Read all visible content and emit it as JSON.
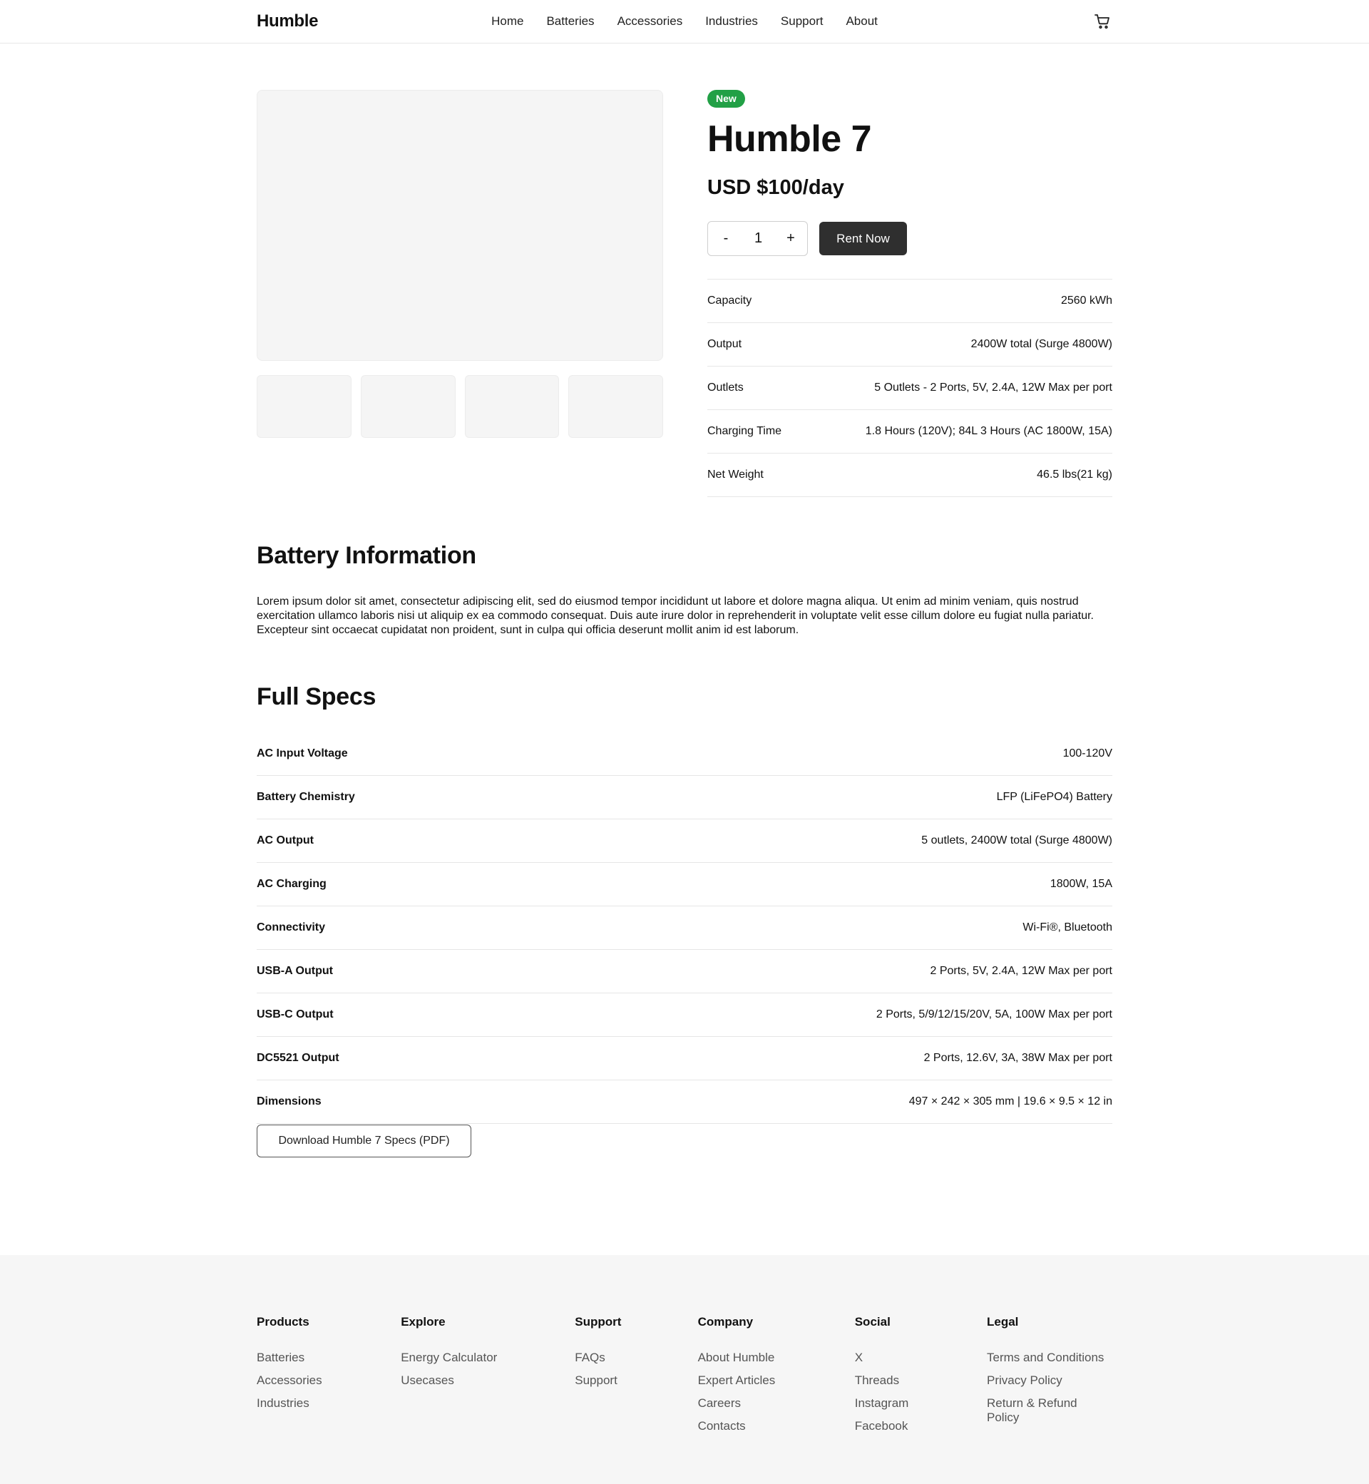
{
  "header": {
    "logo": "Humble",
    "nav": [
      "Home",
      "Batteries",
      "Accessories",
      "Industries",
      "Support",
      "About"
    ]
  },
  "product": {
    "badge": "New",
    "title": "Humble 7",
    "price": "USD $100/day",
    "quantity": {
      "minus": "-",
      "value": "1",
      "plus": "+"
    },
    "rent_label": "Rent Now",
    "key_specs": [
      {
        "label": "Capacity",
        "value": "2560 kWh"
      },
      {
        "label": "Output",
        "value": "2400W total (Surge 4800W)"
      },
      {
        "label": "Outlets",
        "value": "5 Outlets - 2 Ports, 5V, 2.4A, 12W Max per port"
      },
      {
        "label": "Charging Time",
        "value": "1.8 Hours (120V); 84L 3 Hours (AC 1800W, 15A)"
      },
      {
        "label": "Net Weight",
        "value": "46.5 lbs(21 kg)"
      }
    ]
  },
  "battery_info": {
    "title": "Battery Information",
    "body": "Lorem ipsum dolor sit amet, consectetur adipiscing elit, sed do eiusmod tempor incididunt ut labore et dolore magna aliqua. Ut enim ad minim veniam, quis nostrud exercitation ullamco laboris nisi ut aliquip ex ea commodo consequat. Duis aute irure dolor in reprehenderit in voluptate velit esse cillum dolore eu fugiat nulla pariatur. Excepteur sint occaecat cupidatat non proident, sunt in culpa qui officia deserunt mollit anim id est laborum."
  },
  "full_specs": {
    "title": "Full Specs",
    "rows": [
      {
        "label": "AC Input Voltage",
        "value": "100-120V"
      },
      {
        "label": "Battery Chemistry",
        "value": "LFP (LiFePO4) Battery"
      },
      {
        "label": "AC Output",
        "value": "5 outlets, 2400W total (Surge 4800W)"
      },
      {
        "label": "AC Charging",
        "value": "1800W, 15A"
      },
      {
        "label": "Connectivity",
        "value": "Wi-Fi®, Bluetooth"
      },
      {
        "label": "USB-A Output",
        "value": "2 Ports, 5V, 2.4A, 12W Max per port"
      },
      {
        "label": "USB-C Output",
        "value": "2 Ports, 5/9/12/15/20V, 5A, 100W Max per port"
      },
      {
        "label": "DC5521 Output",
        "value": "2 Ports, 12.6V, 3A, 38W Max per port"
      },
      {
        "label": "Dimensions",
        "value": "497 × 242 × 305 mm | 19.6 × 9.5 × 12 in"
      }
    ],
    "download_label": "Download Humble 7 Specs (PDF)"
  },
  "footer": {
    "columns": [
      {
        "title": "Products",
        "links": [
          "Batteries",
          "Accessories",
          "Industries"
        ]
      },
      {
        "title": "Explore",
        "links": [
          "Energy Calculator",
          "Usecases"
        ]
      },
      {
        "title": "Support",
        "links": [
          "FAQs",
          "Support"
        ]
      },
      {
        "title": "Company",
        "links": [
          "About Humble",
          "Expert Articles",
          "Careers",
          "Contacts"
        ]
      },
      {
        "title": "Social",
        "links": [
          "X",
          "Threads",
          "Instagram",
          "Facebook"
        ]
      },
      {
        "title": "Legal",
        "links": [
          "Terms and Conditions",
          "Privacy Policy",
          "Return & Refund Policy"
        ]
      }
    ]
  },
  "colors": {
    "badge": "#22a046",
    "primary_button": "#2f2f2f",
    "footer_bg": "#f6f6f6"
  },
  "icons": {
    "cart": "cart-icon"
  }
}
